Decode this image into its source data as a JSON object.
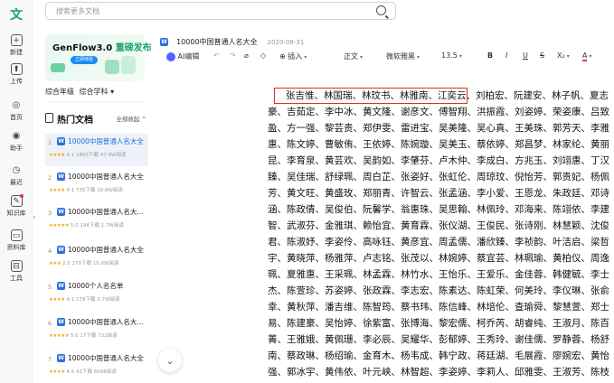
{
  "logo_glyph": "文",
  "search": {
    "placeholder": "搜索更多文档"
  },
  "rail": {
    "items": [
      {
        "label": "新建",
        "icon": "plus-icon"
      },
      {
        "label": "上传",
        "icon": "upload-icon"
      },
      {
        "label": "首页",
        "icon": "home-icon"
      },
      {
        "label": "助手",
        "icon": "assistant-icon"
      },
      {
        "label": "最近",
        "icon": "clock-icon"
      },
      {
        "label": "知识库",
        "icon": "knowledge-icon"
      },
      {
        "label": "资料库",
        "icon": "folder-icon"
      },
      {
        "label": "工具",
        "icon": "toolbox-icon"
      }
    ]
  },
  "banner": {
    "title_prefix": "GenFlow3.0 ",
    "title_highlight": "重磅发布",
    "button": "立即体验"
  },
  "filters": {
    "grade": "综合年级",
    "subject": "综合学科 ▾"
  },
  "hot": {
    "title": "热门文档",
    "fold": "全部收起 ^"
  },
  "docs": [
    {
      "rank": "1",
      "title": "10000中国普通人名大全",
      "stars": "★★★★",
      "rating": "4.1",
      "downloads": "1865下载",
      "reads": "47.9W阅读",
      "selected": true
    },
    {
      "rank": "2",
      "title": "10000中国普通人名大全",
      "stars": "★★★★",
      "rating": "4.1",
      "downloads": "735下载",
      "reads": "10.8W阅读",
      "selected": false
    },
    {
      "rank": "3",
      "title": "10000中国普通人名大...",
      "stars": "★★★★★",
      "rating": "5.0",
      "downloads": "194下载",
      "reads": "1.7W阅读",
      "selected": false
    },
    {
      "rank": "4",
      "title": "10000中国普通人名大全",
      "stars": "★★★",
      "rating": "2.5",
      "downloads": "279下载",
      "reads": "15.0W阅读",
      "selected": false
    },
    {
      "rank": "5",
      "title": "10000个人名名单",
      "stars": "★★★★",
      "rating": "4.1",
      "downloads": "178下载",
      "reads": "3.7W阅读",
      "selected": false
    },
    {
      "rank": "6",
      "title": "10000中国普通人名大...",
      "stars": "★★★★★",
      "rating": "5.0",
      "downloads": "17下载",
      "reads": "732阅读",
      "selected": false
    },
    {
      "rank": "7",
      "title": "10000中国普通人名大全",
      "stars": "★★★★",
      "rating": "4.5",
      "downloads": "41下载",
      "reads": "6098阅读",
      "selected": false
    }
  ],
  "doc": {
    "badge": "W",
    "title": "10000中国普通人名大全",
    "date": "2020-08-31"
  },
  "toolbar": {
    "ai": "AI编辑",
    "insert": "插入",
    "style": "正文",
    "font": "微软雅黑",
    "size": "13.5",
    "bold": "B",
    "italic": "I",
    "underline": "U",
    "strike": "S",
    "sub": "X₂",
    "color": "A"
  },
  "colors": {
    "accent_green": "#17a36a",
    "link_blue": "#1b6fe0",
    "highlight_red": "#e0301e"
  },
  "body_lines": [
    "张吉惟、林国瑞、林玟书、林雅南、江奕云、刘柏宏、阮建安、林子帆、夏志",
    "豪、吉茹定、李中冰、黄文隆、谢彦文、傅智翔、洪振霞、刘姿婷、荣姿康、吕致",
    "盈、方一强、黎芸贵、郑伊雯、雷进宝、吴美隆、吴心真、王美珠、郭芳天、李雅",
    "惠、陈文婷、曹敏侑、王依婷、陈婉璇、吴美玉、蔡依婷、郑昌梦、林家纶、黄丽",
    "昆、李育泉、黄芸欢、吴韵如、李肇芬、卢木仲、李成白、方兆玉、刘翊惠、丁汉",
    "臻、吴佳瑞、舒绿珮、周白芷、张姿好、张虹伦、周琼玟、倪怡芳、郭贵妃、杨佩",
    "芳、黄文旺、黄盛玫、郑丽青、许智云、张孟涵、李小爱、王恩龙、朱政廷、邓诗",
    "涵、陈政倩、吴俊伯、阮馨学、翁惠珠、吴思翰、林佩玲、邓海来、陈翊依、李建",
    "智、武淑芬、金雅琪、赖怡宜、黄育霖、张仪湖、王俊民、张诗刚、林慧颖、沈俊",
    "君、陈淑妤、李姿伶、高咏钰、黄彦宜、周孟儒、潘欣臻、李祯韵、叶洁启、梁哲",
    "宇、黄晓萍、杨雅萍、卢志铭、张茂以、林婉婷、蔡宜芸、林珮瑜、黄柏仪、周逸",
    "珮、夏雅惠、王采珮、林孟霖、林竹水、王怡乐、王爱乐、金佳蓉、韩健毓、李士",
    "杰、陈萱珍、苏姿婷、张政霖、李志宏、陈素达、陈虹荣、何美玲、李仪琳、张俞",
    "幸、黄秋萍、潘吉维、陈智筠、蔡书玮、陈信峰、林培伦、查瑜舜、黎慧萱、郑士",
    "易、陈建豪、吴怡婷、徐紫富、张博海、黎宏儒、柯乔芮、胡睿纯、王淑月、陈百",
    "菁、王雅娥、黄佩珊、李必辰、吴耀华、彭郁婷、王秀玲、谢佳儒、罗静蓉、杨舒",
    "南、蔡政琳、杨绍瑜、金育木、杨韦成、韩宁政、蒋廷湖、毛展霞、廖婉宏、黄怡",
    "强、郭冰宇、黄伟依、叶元峡、林智超、李姿婷、李莉人、邱雅雯、王淑芳、陈枝"
  ]
}
